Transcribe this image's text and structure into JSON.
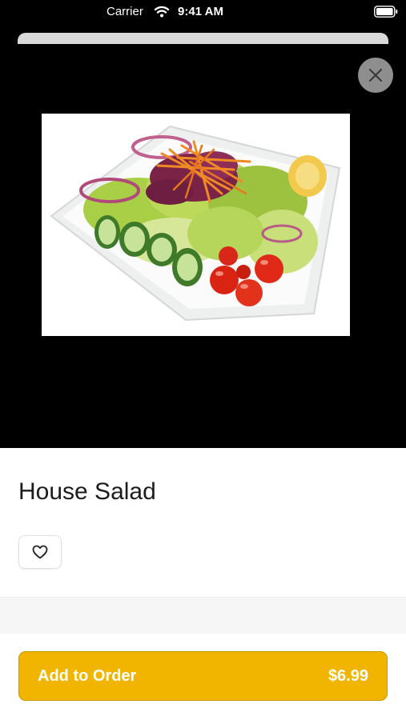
{
  "status_bar": {
    "carrier": "Carrier",
    "time": "9:41 AM",
    "icons": [
      "wifi-icon",
      "battery-icon"
    ]
  },
  "modal": {
    "close_icon": "close-icon"
  },
  "item": {
    "photo_icon": "salad-illustration",
    "title": "House Salad",
    "favorite_icon": "heart-outline-icon"
  },
  "action": {
    "add_label": "Add to Order",
    "price": "$6.99"
  },
  "colors": {
    "background": "#000000",
    "accent": "#f1b500",
    "close_button": "#8e8e8e"
  }
}
